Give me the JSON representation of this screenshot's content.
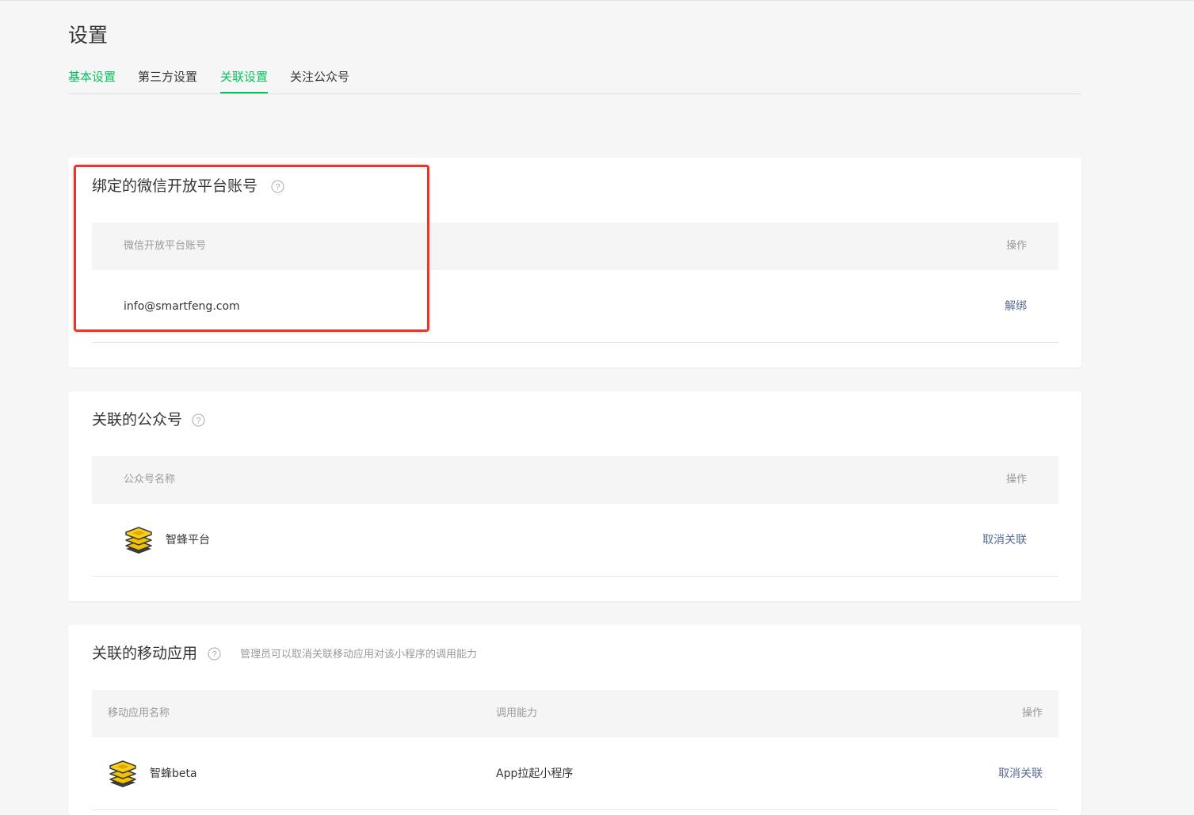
{
  "page": {
    "title": "设置"
  },
  "tabs": [
    {
      "label": "基本设置"
    },
    {
      "label": "第三方设置"
    },
    {
      "label": "关联设置"
    },
    {
      "label": "关注公众号"
    }
  ],
  "open_platform": {
    "title": "绑定的微信开放平台账号",
    "columns": {
      "account": "微信开放平台账号",
      "action": "操作"
    },
    "row": {
      "account": "info@smartfeng.com",
      "action": "解绑"
    }
  },
  "official_accounts": {
    "title": "关联的公众号",
    "columns": {
      "name": "公众号名称",
      "action": "操作"
    },
    "row": {
      "name": "智蜂平台",
      "logo_icon": "bee-hive-logo-icon",
      "action": "取消关联"
    }
  },
  "mobile_apps": {
    "title": "关联的移动应用",
    "tip": "管理员可以取消关联移动应用对该小程序的调用能力",
    "columns": {
      "name": "移动应用名称",
      "capability": "调用能力",
      "action": "操作"
    },
    "row": {
      "name": "智蜂beta",
      "logo_icon": "bee-hive-logo-icon",
      "capability": "App拉起小程序",
      "action": "取消关联"
    }
  },
  "colors": {
    "accent": "#07c160",
    "link": "#576b95",
    "highlight": "#e8362a",
    "background": "#f6f6f6"
  }
}
